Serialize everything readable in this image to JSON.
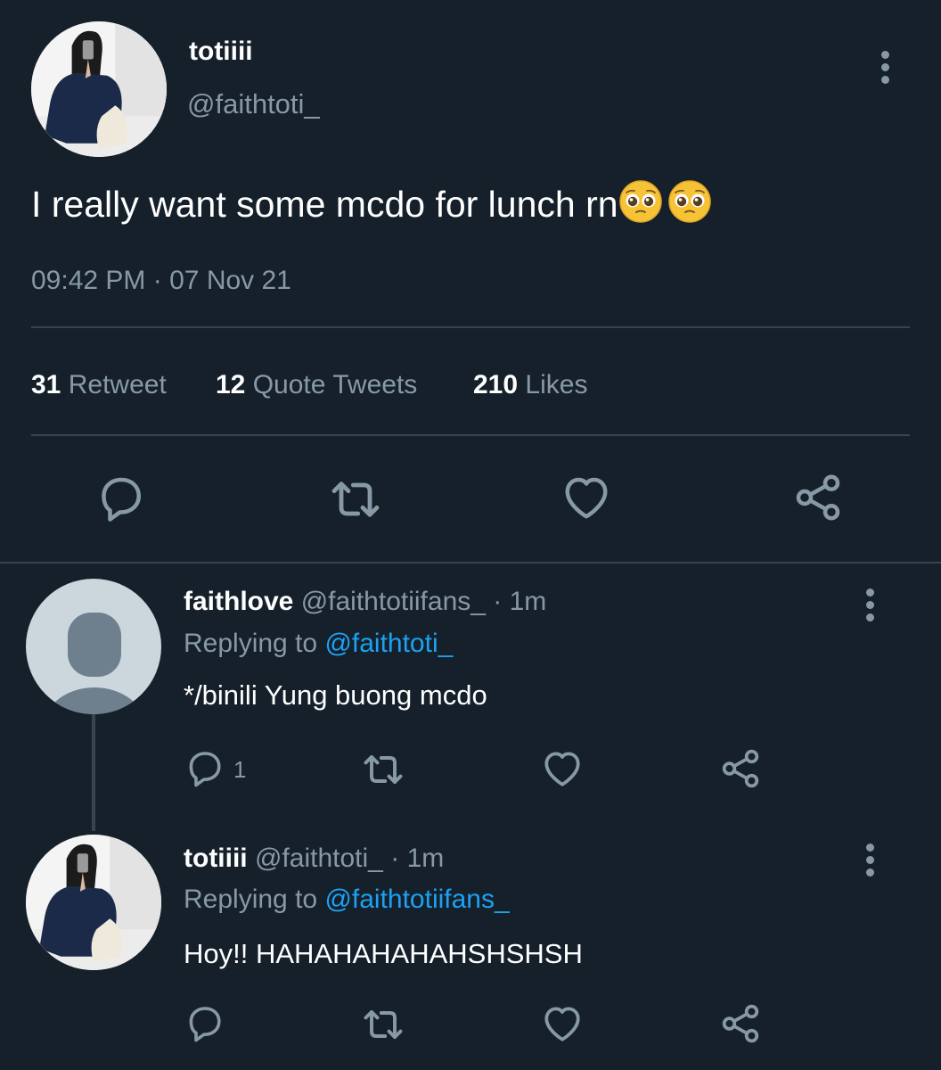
{
  "main_tweet": {
    "display_name": "totiiii",
    "handle": "@faithtoti_",
    "text": "I really want some mcdo for lunch rn",
    "emojis": [
      "pleading-face",
      "pleading-face"
    ],
    "time": "09:42 PM",
    "separator": "·",
    "date": "07 Nov 21",
    "stats": {
      "retweets": {
        "count": "31",
        "label": "Retweet"
      },
      "quotes": {
        "count": "12",
        "label": "Quote Tweets"
      },
      "likes": {
        "count": "210",
        "label": "Likes"
      }
    }
  },
  "replies": [
    {
      "display_name": "faithlove",
      "handle": "@faithtotiifans_",
      "separator": "·",
      "time_ago": "1m",
      "replying_prefix": "Replying to",
      "replying_to": "@faithtoti_",
      "text": "*/binili Yung buong mcdo",
      "reply_count": "1",
      "avatar": "default-avatar-icon"
    },
    {
      "display_name": "totiiii",
      "handle": "@faithtoti_",
      "separator": "·",
      "time_ago": "1m",
      "replying_prefix": "Replying to",
      "replying_to": "@faithtotiifans_",
      "text": "Hoy!! HAHAHAHAHAHSHSHSH",
      "reply_count": "",
      "avatar": "profile-photo"
    }
  ],
  "colors": {
    "background": "#15202b",
    "text": "#ffffff",
    "muted": "#8899a6",
    "link": "#1da1f2",
    "divider": "#38444d"
  }
}
